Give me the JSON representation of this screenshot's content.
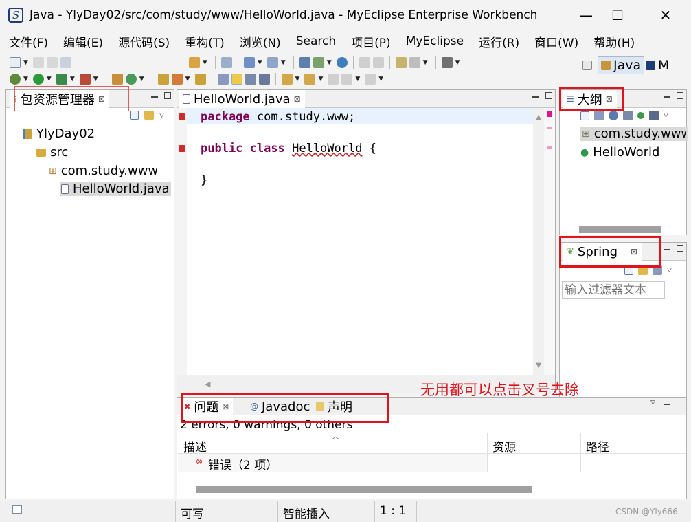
{
  "window": {
    "title": "Java  -  YlyDay02/src/com/study/www/HelloWorld.java  -  MyEclipse Enterprise Workbench",
    "logo_letter": "S",
    "minimize_glyph": "—",
    "maximize_glyph": "☐",
    "close_glyph": "✕"
  },
  "menu": [
    "文件(F)",
    "编辑(E)",
    "源代码(S)",
    "重构(T)",
    "浏览(N)",
    "Search",
    "项目(P)",
    "MyEclipse",
    "运行(R)",
    "窗口(W)",
    "帮助(H)"
  ],
  "perspectives": {
    "java": "Java",
    "myeclipse": "M"
  },
  "package_explorer": {
    "title": "包资源管理器",
    "tree": [
      "YlyDay02",
      "src",
      "com.study.www",
      "HelloWorld.java"
    ]
  },
  "editor": {
    "tab": "HelloWorld.java",
    "lines": {
      "l1_kw": "package",
      "l1_rest": " com.study.www;",
      "l3_kw1": "public",
      "l3_kw2": "class",
      "l3_name": "HelloWorld",
      "l3_brace": " {",
      "l5": "}"
    }
  },
  "outline": {
    "title": "大纲",
    "items": [
      "com.study.www",
      "HelloWorld"
    ]
  },
  "spring": {
    "title": "Spring",
    "filter_placeholder": "输入过滤器文本"
  },
  "bottom": {
    "tabs": [
      "问题",
      "Javadoc",
      "声明"
    ],
    "summary": "2 errors, 0 warnings, 0 others",
    "columns": [
      "描述",
      "资源",
      "路径"
    ],
    "rows": [
      {
        "label": "错误（2 项）"
      }
    ]
  },
  "annotation": "无用都可以点击叉号去除",
  "status": {
    "writable": "可写",
    "insert_mode": "智能插入",
    "position": "1 : 1"
  },
  "watermark": "CSDN @Yly666_",
  "colors": {
    "keyword": "#7f0055",
    "annotation_red": "#e1141e",
    "error_red": "#d12a2a"
  }
}
